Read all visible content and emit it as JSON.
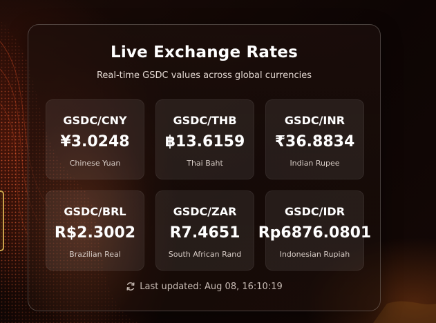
{
  "panel": {
    "title": "Live Exchange Rates",
    "subtitle": "Real-time GSDC values across global currencies"
  },
  "rates": [
    {
      "pair": "GSDC/CNY",
      "rate": "¥3.0248",
      "currency": "Chinese Yuan"
    },
    {
      "pair": "GSDC/THB",
      "rate": "฿13.6159",
      "currency": "Thai Baht"
    },
    {
      "pair": "GSDC/INR",
      "rate": "₹36.8834",
      "currency": "Indian Rupee"
    },
    {
      "pair": "GSDC/BRL",
      "rate": "R$2.3002",
      "currency": "Brazilian Real"
    },
    {
      "pair": "GSDC/ZAR",
      "rate": "R7.4651",
      "currency": "South African Rand"
    },
    {
      "pair": "GSDC/IDR",
      "rate": "Rp6876.0801",
      "currency": "Indonesian Rupiah"
    }
  ],
  "status": {
    "last_updated": "Last updated: Aug 08, 16:10:19",
    "icon": "refresh-icon"
  },
  "colors": {
    "accent": "#e8703a",
    "text": "#ffffff"
  }
}
